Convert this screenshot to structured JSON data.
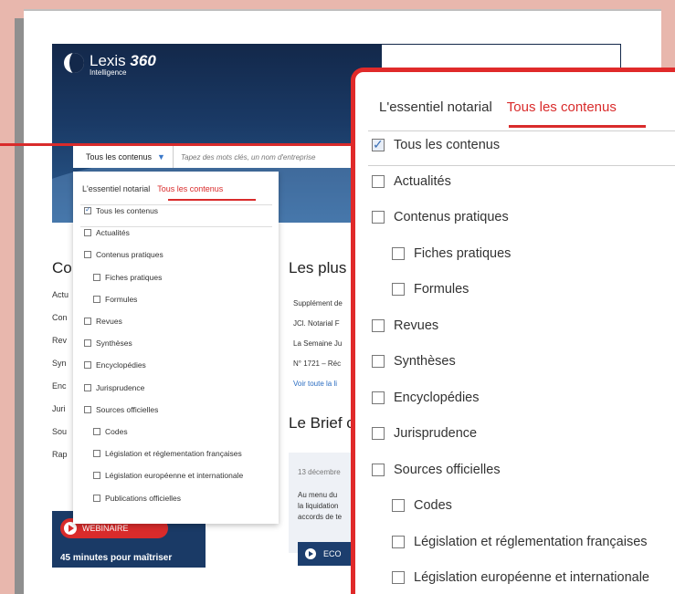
{
  "logo": {
    "name": "Lexis",
    "suffix": "360",
    "sub": "Intelligence"
  },
  "search": {
    "scope": "Tous les contenus",
    "placeholder": "Tapez des mots clés, un nom d'entreprise"
  },
  "background": {
    "left_title": "Co",
    "left_items": [
      "Actu",
      "Con",
      "Rev",
      "Syn",
      "Enc",
      "Juri",
      "Sou",
      "Rap"
    ],
    "mid_title": "Les plus c",
    "mid_items": [
      "Supplément de",
      "JCl. Notarial F",
      "La Semaine Ju",
      "N° 1721 – Réc",
      "Voir toute la li"
    ],
    "brief_title": "Le Brief c",
    "brief_date": "13 décembre",
    "brief_text": [
      "Au menu du",
      "la liquidation",
      "accords de te"
    ],
    "brief_button": "ECO",
    "webinar_badge": "WEBINAIRE",
    "webinar_text": "45 minutes pour maîtriser"
  },
  "dropdown": {
    "tabs": [
      "L'essentiel notarial",
      "Tous les contenus"
    ],
    "options": [
      {
        "label": "Tous les contenus",
        "checked": true,
        "indent": 0
      },
      {
        "label": "Actualités",
        "checked": false,
        "indent": 0
      },
      {
        "label": "Contenus pratiques",
        "checked": false,
        "indent": 0
      },
      {
        "label": "Fiches pratiques",
        "checked": false,
        "indent": 1
      },
      {
        "label": "Formules",
        "checked": false,
        "indent": 1
      },
      {
        "label": "Revues",
        "checked": false,
        "indent": 0
      },
      {
        "label": "Synthèses",
        "checked": false,
        "indent": 0
      },
      {
        "label": "Encyclopédies",
        "checked": false,
        "indent": 0
      },
      {
        "label": "Jurisprudence",
        "checked": false,
        "indent": 0
      },
      {
        "label": "Sources officielles",
        "checked": false,
        "indent": 0
      },
      {
        "label": "Codes",
        "checked": false,
        "indent": 1
      },
      {
        "label": "Législation et réglementation françaises",
        "checked": false,
        "indent": 1
      },
      {
        "label": "Législation européenne et internationale",
        "checked": false,
        "indent": 1
      },
      {
        "label": "Publications officielles",
        "checked": false,
        "indent": 1
      }
    ]
  },
  "colors": {
    "accent": "#d92b2b",
    "navy": "#13284a",
    "highlight_border": "#e02a2a"
  }
}
